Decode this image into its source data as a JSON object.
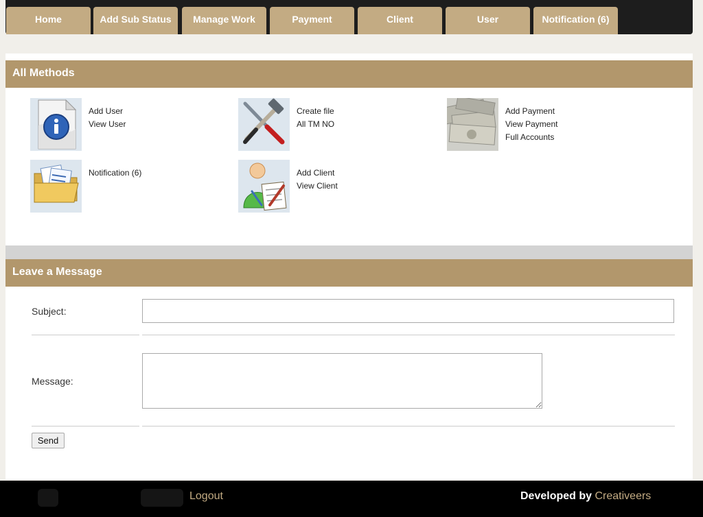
{
  "nav": {
    "tabs": [
      {
        "label": "Home"
      },
      {
        "label": "Add Sub Status"
      },
      {
        "label": "Manage Work"
      },
      {
        "label": "Payment"
      },
      {
        "label": "Client"
      },
      {
        "label": "User"
      },
      {
        "label": "Notification (6)"
      }
    ]
  },
  "methods": {
    "title": "All Methods",
    "user": {
      "icon": "info-document-icon",
      "links": [
        "Add User",
        "View User"
      ]
    },
    "work": {
      "icon": "tools-icon",
      "links": [
        "Create file",
        "All TM NO"
      ]
    },
    "payment": {
      "icon": "money-icon",
      "links": [
        "Add Payment",
        "View Payment",
        "Full Accounts"
      ]
    },
    "notification": {
      "icon": "folder-documents-icon",
      "links": [
        "Notification (6)"
      ]
    },
    "client": {
      "icon": "client-user-icon",
      "links": [
        "Add Client",
        "View Client"
      ]
    }
  },
  "message": {
    "title": "Leave a Message",
    "subject_label": "Subject:",
    "subject_value": "",
    "message_label": "Message:",
    "message_value": "",
    "send_label": "Send"
  },
  "footer": {
    "logout_label": "Logout",
    "developed_by_prefix": "Developed by ",
    "developed_by_name": "Creativeers"
  },
  "colors": {
    "tab_bg": "#c3ab83",
    "header_bg": "#b2976c",
    "nav_bg": "#1d1d1d",
    "footer_bg": "#000000",
    "accent_text": "#c3ab83"
  }
}
